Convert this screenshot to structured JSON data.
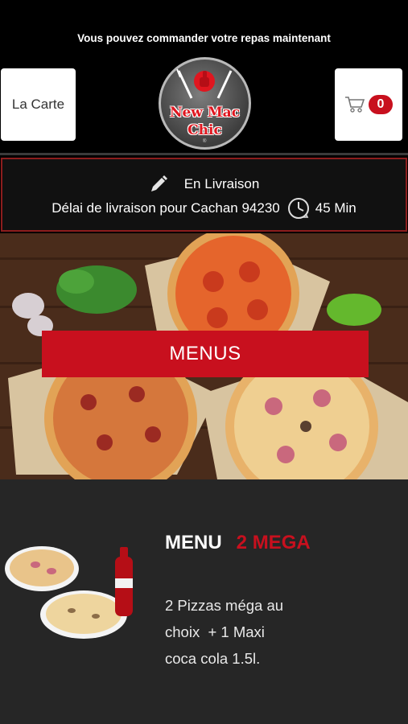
{
  "header": {
    "tagline": "Vous pouvez commander votre repas maintenant",
    "menu_button_label": "La Carte",
    "cart_count": "0",
    "logo": {
      "line1": "New Mac",
      "line2": "Chic",
      "registered": "®"
    }
  },
  "delivery": {
    "mode": "En Livraison",
    "delay_text": "Délai de livraison pour Cachan 94230",
    "delay_time": "45 Min"
  },
  "banner": {
    "button_label": "MENUS"
  },
  "product": {
    "title": "MENU",
    "title_accent": "2 MEGA",
    "description_lines": [
      "2 Pizzas méga au",
      "choix  + 1 Maxi",
      "coca cola 1.5l."
    ]
  },
  "colors": {
    "accent": "#c8101e",
    "background": "#000000",
    "panel": "#262626"
  },
  "icons": {
    "cart": "cart-icon",
    "pencil": "pencil-icon",
    "clock": "clock-icon"
  }
}
